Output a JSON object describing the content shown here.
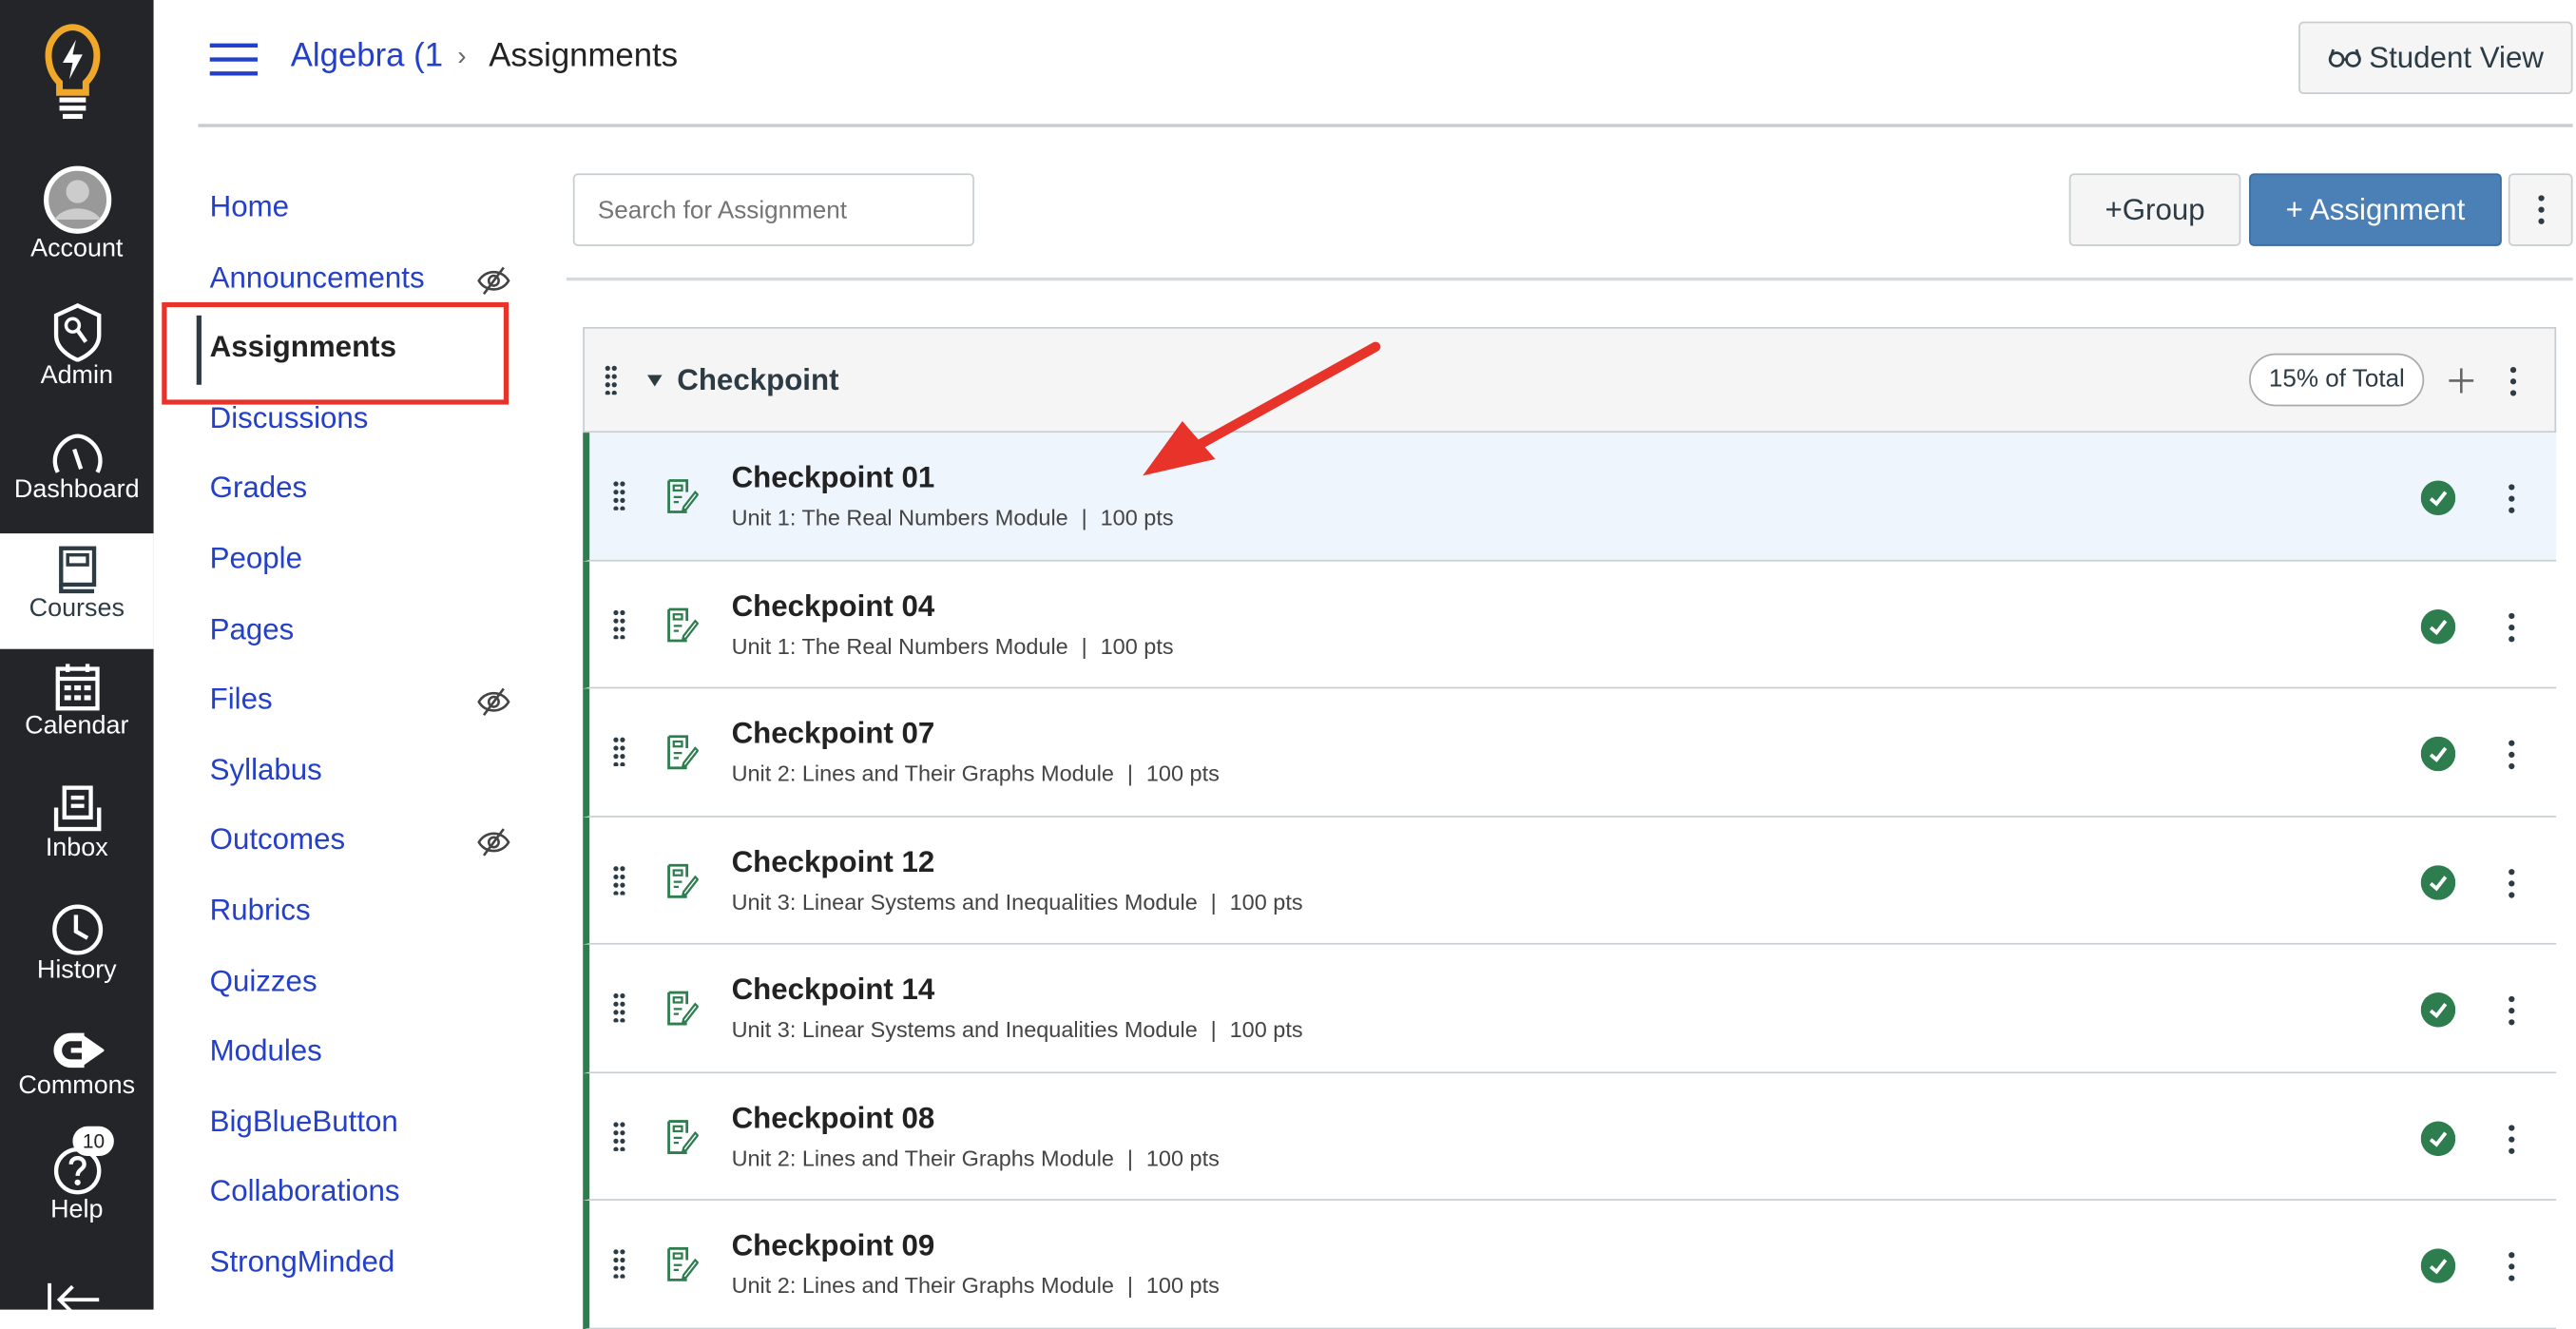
{
  "global_nav": {
    "items": [
      {
        "label": "Account",
        "icon": "user-avatar-icon"
      },
      {
        "label": "Admin",
        "icon": "shield-key-icon"
      },
      {
        "label": "Dashboard",
        "icon": "speedometer-icon"
      },
      {
        "label": "Courses",
        "icon": "book-icon",
        "active": true
      },
      {
        "label": "Calendar",
        "icon": "calendar-icon"
      },
      {
        "label": "Inbox",
        "icon": "inbox-icon"
      },
      {
        "label": "History",
        "icon": "clock-icon"
      },
      {
        "label": "Commons",
        "icon": "commons-icon"
      },
      {
        "label": "Help",
        "icon": "help-icon",
        "badge": "10"
      }
    ]
  },
  "header": {
    "breadcrumb_course": "Algebra (1",
    "breadcrumb_separator": "›",
    "breadcrumb_page": "Assignments",
    "student_view": "Student View"
  },
  "course_nav": {
    "items": [
      {
        "label": "Home"
      },
      {
        "label": "Announcements",
        "hidden": true
      },
      {
        "label": "Assignments",
        "active": true
      },
      {
        "label": "Discussions"
      },
      {
        "label": "Grades"
      },
      {
        "label": "People"
      },
      {
        "label": "Pages"
      },
      {
        "label": "Files",
        "hidden": true
      },
      {
        "label": "Syllabus"
      },
      {
        "label": "Outcomes",
        "hidden": true
      },
      {
        "label": "Rubrics"
      },
      {
        "label": "Quizzes"
      },
      {
        "label": "Modules"
      },
      {
        "label": "BigBlueButton"
      },
      {
        "label": "Collaborations"
      },
      {
        "label": "StrongMinded"
      }
    ]
  },
  "toolbar": {
    "search_placeholder": "Search for Assignment",
    "group_button": "+Group",
    "assignment_button": "+ Assignment"
  },
  "group": {
    "title": "Checkpoint",
    "weight": "15% of Total"
  },
  "rows": [
    {
      "title": "Checkpoint 01",
      "module": "Unit 1: The Real Numbers Module",
      "points": "100 pts",
      "selected": true
    },
    {
      "title": "Checkpoint 04",
      "module": "Unit 1: The Real Numbers Module",
      "points": "100 pts"
    },
    {
      "title": "Checkpoint 07",
      "module": "Unit 2: Lines and Their Graphs Module",
      "points": "100 pts"
    },
    {
      "title": "Checkpoint 12",
      "module": "Unit 3: Linear Systems and Inequalities Module",
      "points": "100 pts"
    },
    {
      "title": "Checkpoint 14",
      "module": "Unit 3: Linear Systems and Inequalities Module",
      "points": "100 pts"
    },
    {
      "title": "Checkpoint 08",
      "module": "Unit 2: Lines and Their Graphs Module",
      "points": "100 pts"
    },
    {
      "title": "Checkpoint 09",
      "module": "Unit 2: Lines and Their Graphs Module",
      "points": "100 pts"
    }
  ],
  "colors": {
    "nav_bg": "#232529",
    "link": "#2540c8",
    "primary": "#4a80b5",
    "published": "#2e7d4f",
    "annotation": "#e8332a",
    "selected_row": "#eef5fd"
  }
}
